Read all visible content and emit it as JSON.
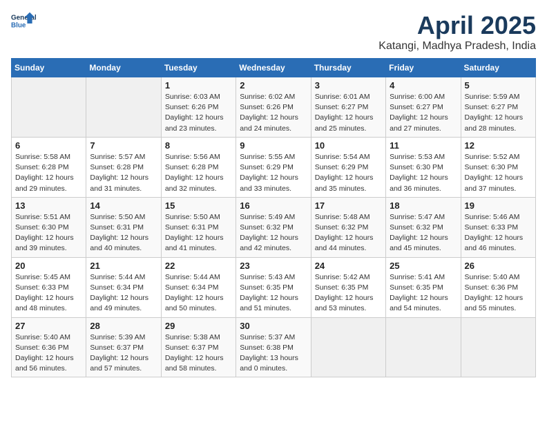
{
  "header": {
    "logo_line1": "General",
    "logo_line2": "Blue",
    "month": "April 2025",
    "location": "Katangi, Madhya Pradesh, India"
  },
  "days_of_week": [
    "Sunday",
    "Monday",
    "Tuesday",
    "Wednesday",
    "Thursday",
    "Friday",
    "Saturday"
  ],
  "weeks": [
    [
      {
        "day": "",
        "empty": true
      },
      {
        "day": "",
        "empty": true
      },
      {
        "day": "1",
        "sunrise": "6:03 AM",
        "sunset": "6:26 PM",
        "daylight": "12 hours and 23 minutes."
      },
      {
        "day": "2",
        "sunrise": "6:02 AM",
        "sunset": "6:26 PM",
        "daylight": "12 hours and 24 minutes."
      },
      {
        "day": "3",
        "sunrise": "6:01 AM",
        "sunset": "6:27 PM",
        "daylight": "12 hours and 25 minutes."
      },
      {
        "day": "4",
        "sunrise": "6:00 AM",
        "sunset": "6:27 PM",
        "daylight": "12 hours and 27 minutes."
      },
      {
        "day": "5",
        "sunrise": "5:59 AM",
        "sunset": "6:27 PM",
        "daylight": "12 hours and 28 minutes."
      }
    ],
    [
      {
        "day": "6",
        "sunrise": "5:58 AM",
        "sunset": "6:28 PM",
        "daylight": "12 hours and 29 minutes."
      },
      {
        "day": "7",
        "sunrise": "5:57 AM",
        "sunset": "6:28 PM",
        "daylight": "12 hours and 31 minutes."
      },
      {
        "day": "8",
        "sunrise": "5:56 AM",
        "sunset": "6:28 PM",
        "daylight": "12 hours and 32 minutes."
      },
      {
        "day": "9",
        "sunrise": "5:55 AM",
        "sunset": "6:29 PM",
        "daylight": "12 hours and 33 minutes."
      },
      {
        "day": "10",
        "sunrise": "5:54 AM",
        "sunset": "6:29 PM",
        "daylight": "12 hours and 35 minutes."
      },
      {
        "day": "11",
        "sunrise": "5:53 AM",
        "sunset": "6:30 PM",
        "daylight": "12 hours and 36 minutes."
      },
      {
        "day": "12",
        "sunrise": "5:52 AM",
        "sunset": "6:30 PM",
        "daylight": "12 hours and 37 minutes."
      }
    ],
    [
      {
        "day": "13",
        "sunrise": "5:51 AM",
        "sunset": "6:30 PM",
        "daylight": "12 hours and 39 minutes."
      },
      {
        "day": "14",
        "sunrise": "5:50 AM",
        "sunset": "6:31 PM",
        "daylight": "12 hours and 40 minutes."
      },
      {
        "day": "15",
        "sunrise": "5:50 AM",
        "sunset": "6:31 PM",
        "daylight": "12 hours and 41 minutes."
      },
      {
        "day": "16",
        "sunrise": "5:49 AM",
        "sunset": "6:32 PM",
        "daylight": "12 hours and 42 minutes."
      },
      {
        "day": "17",
        "sunrise": "5:48 AM",
        "sunset": "6:32 PM",
        "daylight": "12 hours and 44 minutes."
      },
      {
        "day": "18",
        "sunrise": "5:47 AM",
        "sunset": "6:32 PM",
        "daylight": "12 hours and 45 minutes."
      },
      {
        "day": "19",
        "sunrise": "5:46 AM",
        "sunset": "6:33 PM",
        "daylight": "12 hours and 46 minutes."
      }
    ],
    [
      {
        "day": "20",
        "sunrise": "5:45 AM",
        "sunset": "6:33 PM",
        "daylight": "12 hours and 48 minutes."
      },
      {
        "day": "21",
        "sunrise": "5:44 AM",
        "sunset": "6:34 PM",
        "daylight": "12 hours and 49 minutes."
      },
      {
        "day": "22",
        "sunrise": "5:44 AM",
        "sunset": "6:34 PM",
        "daylight": "12 hours and 50 minutes."
      },
      {
        "day": "23",
        "sunrise": "5:43 AM",
        "sunset": "6:35 PM",
        "daylight": "12 hours and 51 minutes."
      },
      {
        "day": "24",
        "sunrise": "5:42 AM",
        "sunset": "6:35 PM",
        "daylight": "12 hours and 53 minutes."
      },
      {
        "day": "25",
        "sunrise": "5:41 AM",
        "sunset": "6:35 PM",
        "daylight": "12 hours and 54 minutes."
      },
      {
        "day": "26",
        "sunrise": "5:40 AM",
        "sunset": "6:36 PM",
        "daylight": "12 hours and 55 minutes."
      }
    ],
    [
      {
        "day": "27",
        "sunrise": "5:40 AM",
        "sunset": "6:36 PM",
        "daylight": "12 hours and 56 minutes."
      },
      {
        "day": "28",
        "sunrise": "5:39 AM",
        "sunset": "6:37 PM",
        "daylight": "12 hours and 57 minutes."
      },
      {
        "day": "29",
        "sunrise": "5:38 AM",
        "sunset": "6:37 PM",
        "daylight": "12 hours and 58 minutes."
      },
      {
        "day": "30",
        "sunrise": "5:37 AM",
        "sunset": "6:38 PM",
        "daylight": "13 hours and 0 minutes."
      },
      {
        "day": "",
        "empty": true
      },
      {
        "day": "",
        "empty": true
      },
      {
        "day": "",
        "empty": true
      }
    ]
  ],
  "labels": {
    "sunrise": "Sunrise:",
    "sunset": "Sunset:",
    "daylight": "Daylight:"
  }
}
